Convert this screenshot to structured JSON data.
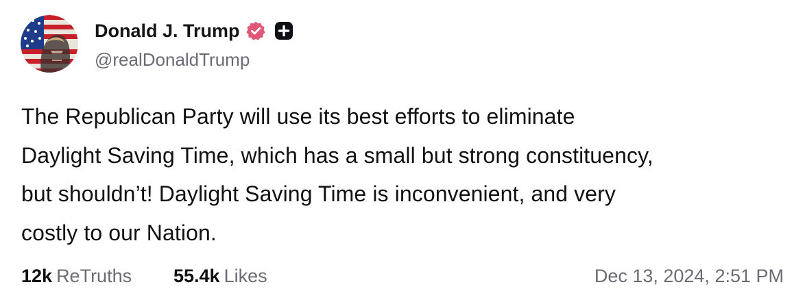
{
  "author": {
    "display_name": "Donald J. Trump",
    "handle": "@realDonaldTrump",
    "verified_icon": "verified-badge-icon",
    "plus_icon": "plus-square-icon"
  },
  "post": {
    "lines": [
      "The Republican Party will use its best efforts to eliminate",
      "Daylight Saving Time, which has a small but strong constituency,",
      "but shouldn’t! Daylight Saving Time is inconvenient, and very",
      "costly to our Nation."
    ]
  },
  "stats": {
    "retruths_count": "12k",
    "retruths_label": "ReTruths",
    "likes_count": "55.4k",
    "likes_label": "Likes"
  },
  "timestamp": "Dec 13, 2024, 2:51 PM",
  "colors": {
    "verified": "#e05877",
    "text_primary": "#111111",
    "text_secondary": "#6b6b76",
    "plus_badge": "#0f0f16"
  }
}
